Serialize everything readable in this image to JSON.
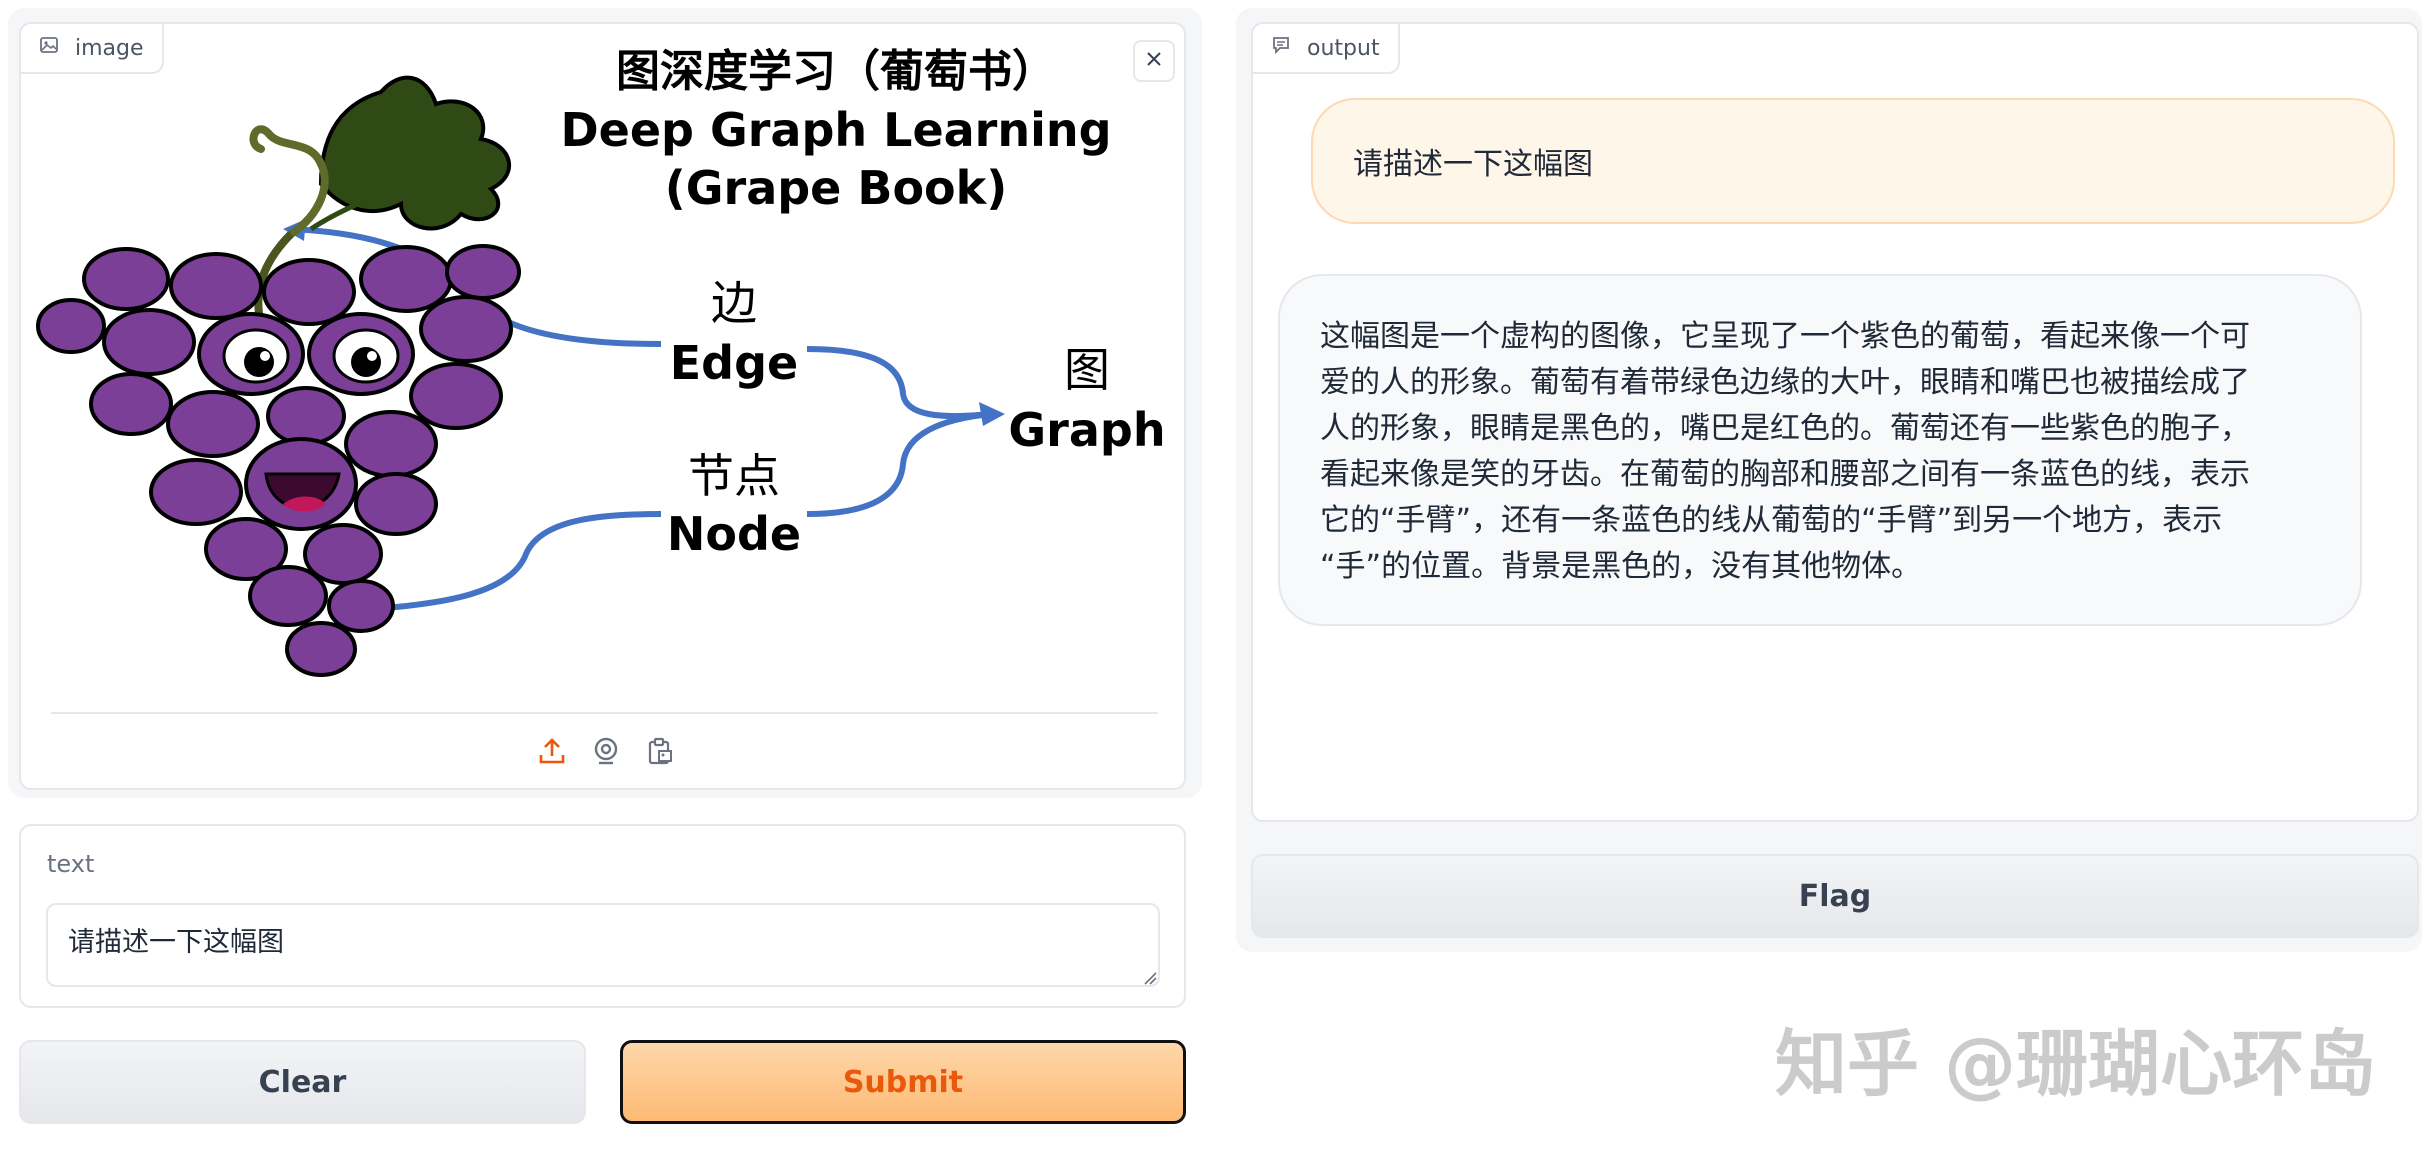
{
  "image_panel": {
    "label": "image",
    "canvas_text": {
      "title_cn": "图深度学习（葡萄书）",
      "title_en_1": "Deep Graph Learning",
      "title_en_2": "(Grape Book)",
      "edge_cn": "边",
      "edge_en": "Edge",
      "node_cn": "节点",
      "node_en": "Node",
      "graph_cn": "图",
      "graph_en": "Graph"
    },
    "toolbar_icons": [
      "upload-icon",
      "webcam-icon",
      "clipboard-icon"
    ]
  },
  "text_panel": {
    "label": "text",
    "value": "请描述一下这幅图"
  },
  "buttons": {
    "clear": "Clear",
    "submit": "Submit",
    "flag": "Flag"
  },
  "output_panel": {
    "label": "output",
    "messages": [
      {
        "role": "user",
        "text": "请描述一下这幅图"
      },
      {
        "role": "bot",
        "lines": [
          "这幅图是一个虚构的图像，它呈现了一个紫色的葡萄，看起来像一个可",
          "爱的人的形象。葡萄有着带绿色边缘的大叶，眼睛和嘴巴也被描绘成了",
          "人的形象，眼睛是黑色的，嘴巴是红色的。葡萄还有一些紫色的胞子，",
          "看起来像是笑的牙齿。在葡萄的胸部和腰部之间有一条蓝色的线，表示",
          "它的“手臂”，还有一条蓝色的线从葡萄的“手臂”到另一个地方，表示",
          "“手”的位置。背景是黑色的，没有其他物体。"
        ]
      }
    ]
  },
  "watermark": "知乎 @珊瑚心环岛",
  "colors": {
    "accent": "#ea580c",
    "primary_button_bg": "#fdba74",
    "grape": "#7b3f98",
    "arrow": "#4472c4",
    "leaf": "#2f4a14"
  }
}
